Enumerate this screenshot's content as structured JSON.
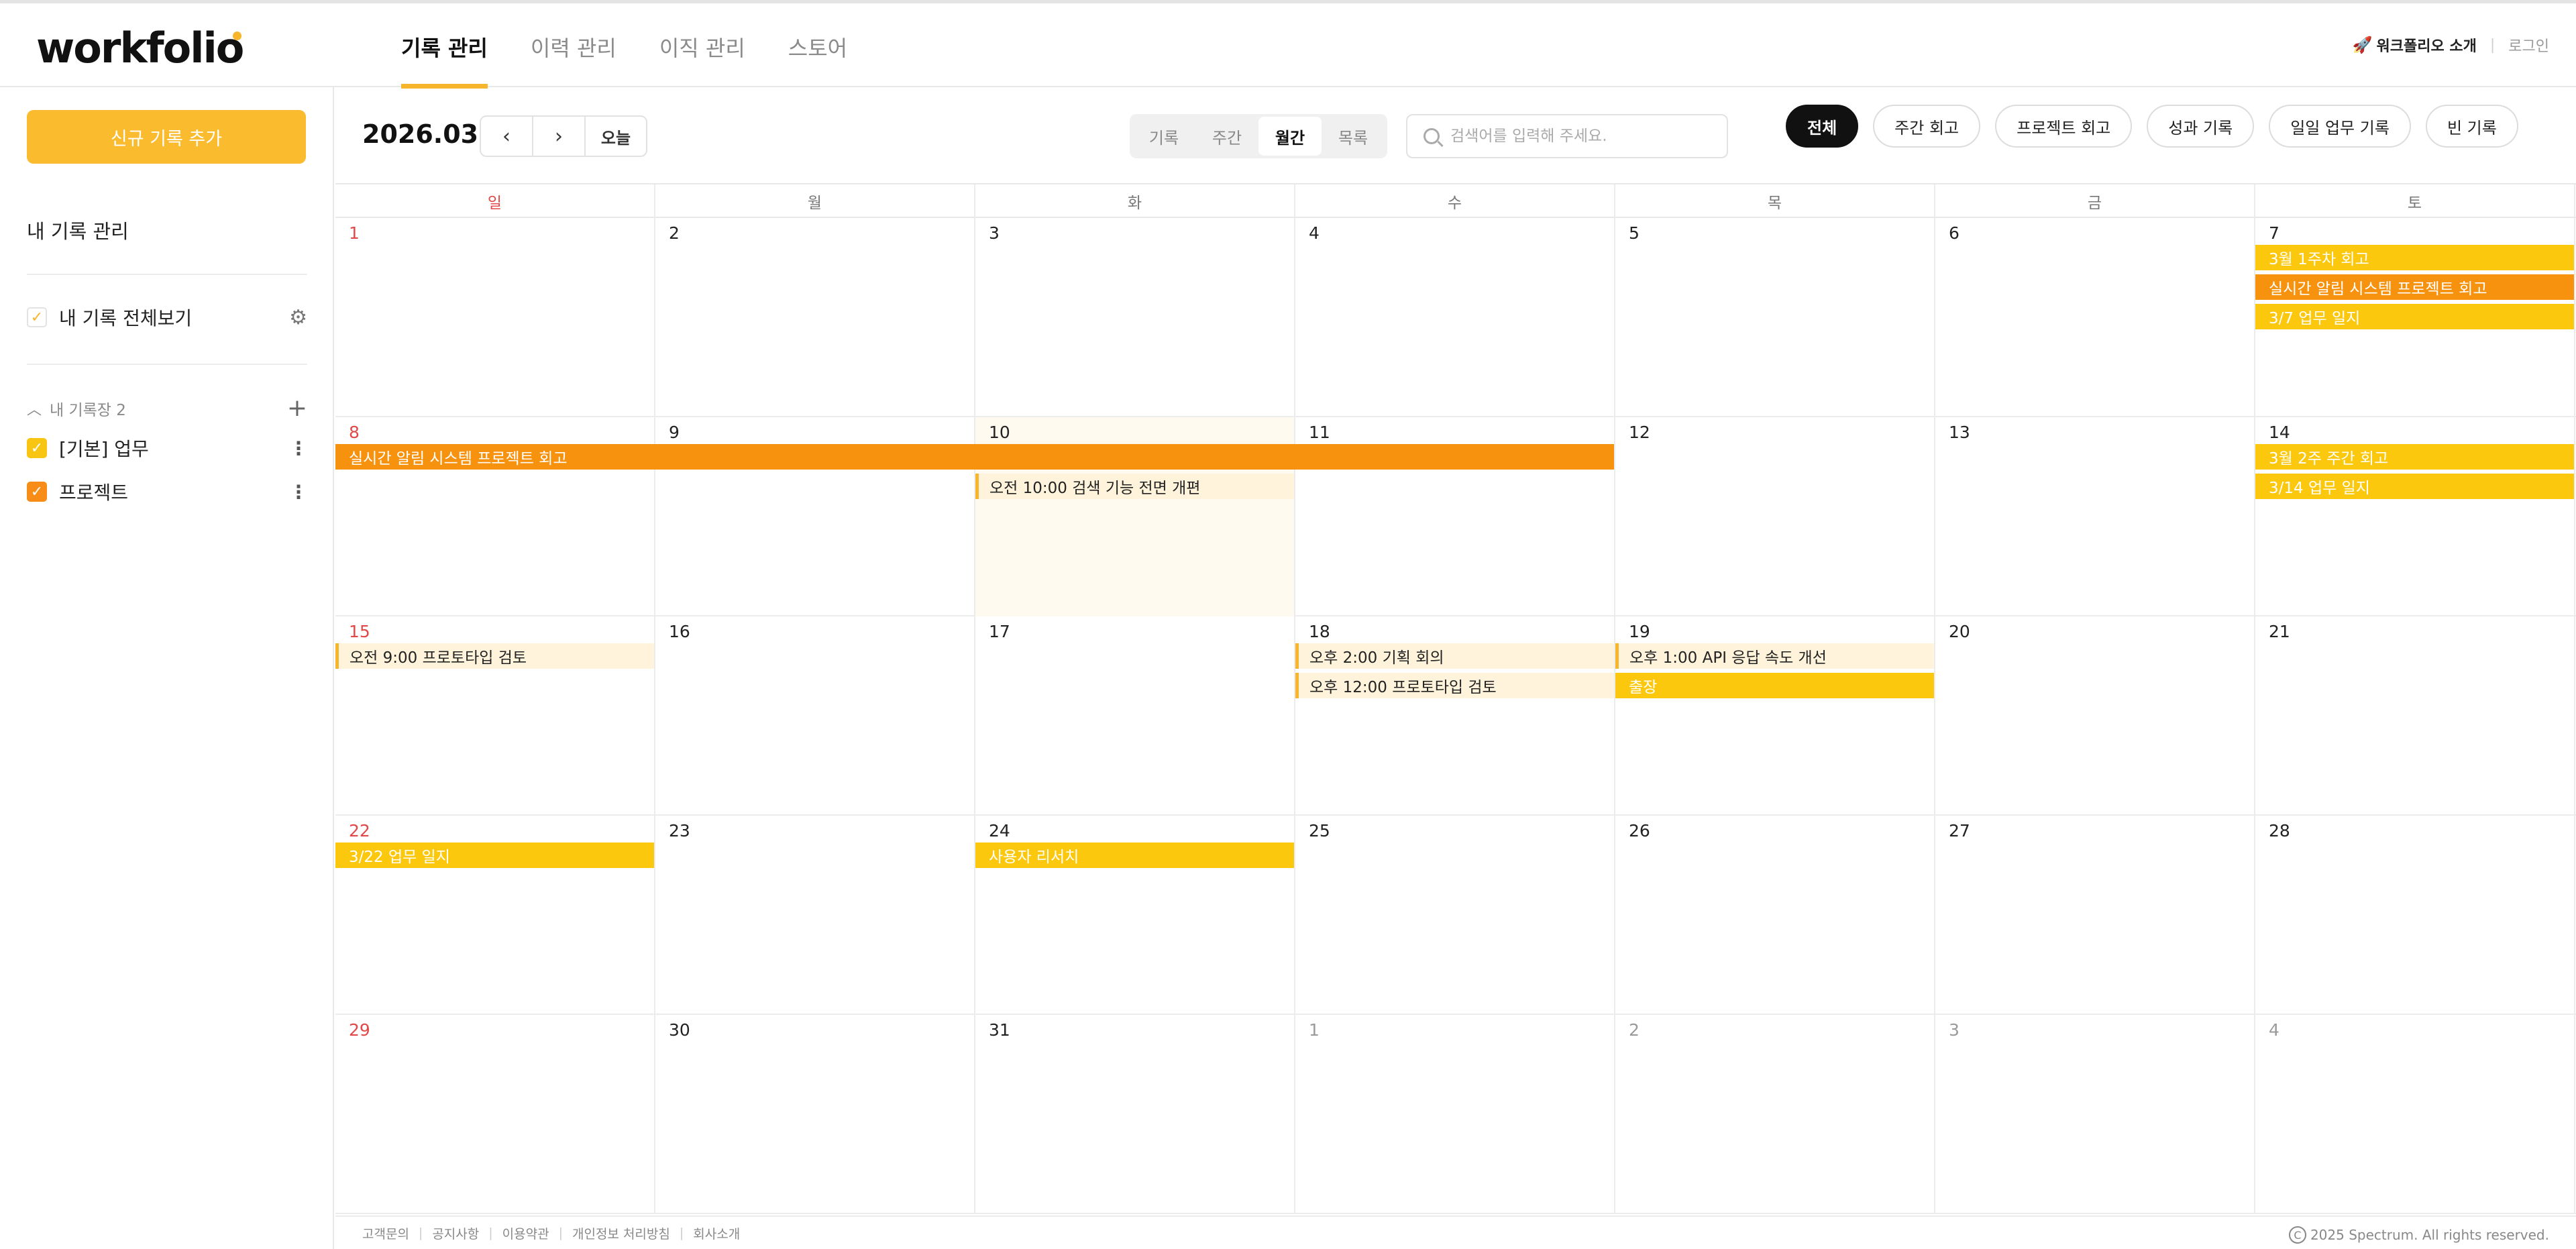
{
  "header": {
    "logo": "workfolio",
    "nav": [
      "기록 관리",
      "이력 관리",
      "이직 관리",
      "스토어"
    ],
    "intro_icon": "rocket-icon",
    "intro": "워크폴리오 소개",
    "login": "로그인"
  },
  "sidebar": {
    "new_button": "신규 기록 추가",
    "title": "내 기록 관리",
    "view_all": "내 기록 전체보기",
    "section_label": "내 기록장 2",
    "books": [
      {
        "label": "[기본] 업무",
        "color": "#f9c513"
      },
      {
        "label": "프로젝트",
        "color": "#f78c16"
      }
    ]
  },
  "toolbar": {
    "month": "2026.03",
    "prev": "‹",
    "next": "›",
    "today": "오늘",
    "views": [
      "기록",
      "주간",
      "월간",
      "목록"
    ],
    "active_view": "월간",
    "search_placeholder": "검색어를 입력해 주세요.",
    "filters": [
      "전체",
      "주간 회고",
      "프로젝트 회고",
      "성과 기록",
      "일일 업무 기록",
      "빈 기록"
    ],
    "active_filter": "전체"
  },
  "calendar": {
    "weekdays": [
      "일",
      "월",
      "화",
      "수",
      "목",
      "금",
      "토"
    ],
    "weeks": [
      [
        {
          "n": "1"
        },
        {
          "n": "2"
        },
        {
          "n": "3"
        },
        {
          "n": "4"
        },
        {
          "n": "5"
        },
        {
          "n": "6"
        },
        {
          "n": "7"
        }
      ],
      [
        {
          "n": "8"
        },
        {
          "n": "9"
        },
        {
          "n": "10"
        },
        {
          "n": "11"
        },
        {
          "n": "12"
        },
        {
          "n": "13"
        },
        {
          "n": "14"
        }
      ],
      [
        {
          "n": "15"
        },
        {
          "n": "16"
        },
        {
          "n": "17"
        },
        {
          "n": "18"
        },
        {
          "n": "19"
        },
        {
          "n": "20"
        },
        {
          "n": "21"
        }
      ],
      [
        {
          "n": "22"
        },
        {
          "n": "23"
        },
        {
          "n": "24"
        },
        {
          "n": "25"
        },
        {
          "n": "26"
        },
        {
          "n": "27"
        },
        {
          "n": "28"
        }
      ],
      [
        {
          "n": "29"
        },
        {
          "n": "30"
        },
        {
          "n": "31"
        },
        {
          "n": "1",
          "other": true
        },
        {
          "n": "2",
          "other": true
        },
        {
          "n": "3",
          "other": true
        },
        {
          "n": "4",
          "other": true
        }
      ]
    ],
    "events": [
      {
        "week": 0,
        "start": 6,
        "span": 1,
        "row": 0,
        "label": "3월 1주차 회고",
        "style": "yellow"
      },
      {
        "week": 0,
        "start": 6,
        "span": 1,
        "row": 1,
        "label": "실시간 알림 시스템 프로젝트 회고",
        "style": "orange"
      },
      {
        "week": 0,
        "start": 6,
        "span": 1,
        "row": 2,
        "label": "3/7 업무 일지",
        "style": "yellow"
      },
      {
        "week": 1,
        "start": 0,
        "span": 4,
        "row": 0,
        "label": "실시간 알림 시스템 프로젝트 회고",
        "style": "orange"
      },
      {
        "week": 1,
        "start": 2,
        "span": 1,
        "row": 1,
        "label": "오전 10:00 검색 기능 전면 개편",
        "style": "light"
      },
      {
        "week": 1,
        "start": 6,
        "span": 1,
        "row": 0,
        "label": "3월 2주 주간 회고",
        "style": "yellow"
      },
      {
        "week": 1,
        "start": 6,
        "span": 1,
        "row": 1,
        "label": "3/14 업무 일지",
        "style": "yellow"
      },
      {
        "week": 2,
        "start": 0,
        "span": 1,
        "row": 0,
        "label": "오전 9:00 프로토타입 검토",
        "style": "light"
      },
      {
        "week": 2,
        "start": 3,
        "span": 1,
        "row": 0,
        "label": "오후 2:00 기획 회의",
        "style": "light"
      },
      {
        "week": 2,
        "start": 3,
        "span": 1,
        "row": 1,
        "label": "오후 12:00 프로토타입 검토",
        "style": "light"
      },
      {
        "week": 2,
        "start": 4,
        "span": 1,
        "row": 0,
        "label": "오후 1:00 API 응답 속도 개선",
        "style": "light"
      },
      {
        "week": 2,
        "start": 4,
        "span": 1,
        "row": 1,
        "label": "출장",
        "style": "yellow"
      },
      {
        "week": 3,
        "start": 0,
        "span": 1,
        "row": 0,
        "label": "3/22 업무 일지",
        "style": "yellow"
      },
      {
        "week": 3,
        "start": 2,
        "span": 1,
        "row": 0,
        "label": "사용자 리서치",
        "style": "yellow"
      }
    ],
    "shaded": [
      {
        "week": 1,
        "day": 2
      }
    ]
  },
  "footer": {
    "links": [
      "고객문의",
      "공지사항",
      "이용약관",
      "개인정보 처리방침",
      "회사소개"
    ],
    "copyright": "2025 Spectrum. All rights reserved."
  }
}
